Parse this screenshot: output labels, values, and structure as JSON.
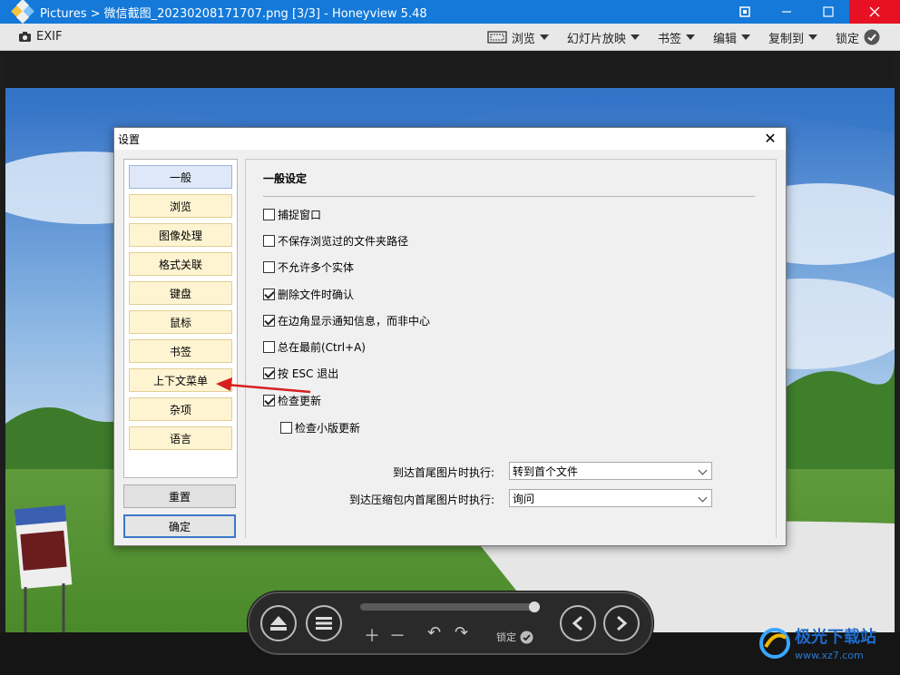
{
  "window": {
    "title": "Pictures > 微信截图_20230208171707.png [3/3] - Honeyview 5.48",
    "pin_icon": "pin-icon",
    "minimize_icon": "minimize-icon",
    "maximize_icon": "maximize-icon",
    "close_icon": "close-icon",
    "accent_color": "#1479d8"
  },
  "toolbar": {
    "exif_label": "EXIF",
    "browse_label": "浏览",
    "slideshow_label": "幻灯片放映",
    "bookmark_label": "书签",
    "edit_label": "编辑",
    "copyto_label": "复制到",
    "lock_label": "锁定"
  },
  "dialog": {
    "title": "设置",
    "nav": [
      {
        "label": "一般",
        "active": true
      },
      {
        "label": "浏览"
      },
      {
        "label": "图像处理"
      },
      {
        "label": "格式关联"
      },
      {
        "label": "键盘"
      },
      {
        "label": "鼠标"
      },
      {
        "label": "书签"
      },
      {
        "label": "上下文菜单"
      },
      {
        "label": "杂项"
      },
      {
        "label": "语言"
      }
    ],
    "reset_label": "重置",
    "ok_label": "确定",
    "section_title": "一般设定",
    "options": [
      {
        "label": "捕捉窗口",
        "checked": false
      },
      {
        "label": "不保存浏览过的文件夹路径",
        "checked": false
      },
      {
        "label": "不允许多个实体",
        "checked": false
      },
      {
        "label": "删除文件时确认",
        "checked": true
      },
      {
        "label": "在边角显示通知信息，而非中心",
        "checked": true
      },
      {
        "label": "总在最前(Ctrl+A)",
        "checked": false
      },
      {
        "label": "按 ESC 退出",
        "checked": true
      },
      {
        "label": "检查更新",
        "checked": true
      },
      {
        "label": "检查小版更新",
        "checked": false
      }
    ],
    "end_action_label": "到达首尾图片时执行:",
    "end_action_value": "转到首个文件",
    "archive_action_label": "到达压缩包内首尾图片时执行:",
    "archive_action_value": "询问"
  },
  "controls": {
    "lock_label": "锁定"
  },
  "watermark": {
    "text": "极光下载站",
    "url": "www.xz7.com"
  }
}
